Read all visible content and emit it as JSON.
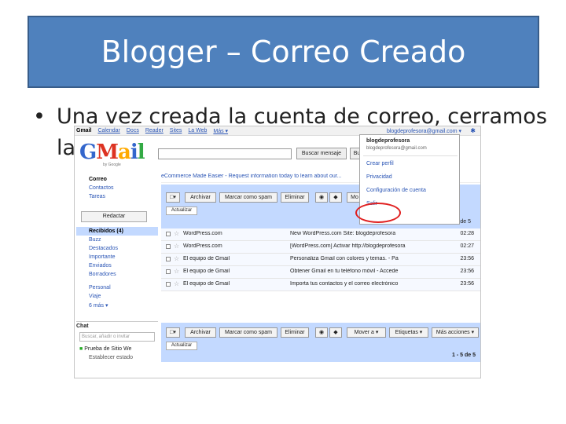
{
  "slide": {
    "title": "Blogger – Correo Creado",
    "bullet_line1": "Una vez creada la cuenta de correo, cerramos",
    "bullet_line2": "la"
  },
  "gmail": {
    "topnav": [
      "Gmail",
      "Calendar",
      "Docs",
      "Reader",
      "Sites",
      "La Web",
      "Más ▾"
    ],
    "account_email": "blogdeprofesora@gmail.com ▾",
    "logo": "Gmail",
    "logo_sub": "by Google",
    "search_button": "Buscar mensaje",
    "search_button2": "Bu",
    "nav_items": [
      "Correo",
      "Contactos",
      "Tareas"
    ],
    "compose": "Redactar",
    "folders": [
      "Recibidos (4)",
      "Buzz",
      "Destacados",
      "Importante",
      "Enviados",
      "Borradores"
    ],
    "labels": [
      "Personal",
      "Viaje",
      "6 más ▾"
    ],
    "chat": {
      "header": "Chat",
      "search_placeholder": "Buscar, añadir o invitar",
      "contact": "Prueba de Sitio We",
      "status": "Establecer estado"
    },
    "promo": "eCommerce Made Easier - Request information today to learn about our...",
    "toolbar": {
      "archive": "Archivar",
      "spam": "Marcar como spam",
      "delete": "Eliminar",
      "move": "Mover a ▾",
      "labels_btn": "Etiquetas ▾",
      "more": "Más acciones ▾",
      "refresh": "Actualizar",
      "count": "1 - 5 de 5"
    },
    "emails": [
      {
        "sender": "WordPress.com",
        "subject": "New WordPress.com Site: blogdeprofesora",
        "time": "02:28"
      },
      {
        "sender": "WordPress.com",
        "subject": "[WordPress.com] Activar http://blogdeprofesora",
        "time": "02:27"
      },
      {
        "sender": "El equipo de Gmail",
        "subject": "Personaliza Gmail con colores y temas. - Pa",
        "time": "23:56"
      },
      {
        "sender": "El equipo de Gmail",
        "subject": "Obtener Gmail en tu teléfono móvil - Accede",
        "time": "23:56"
      },
      {
        "sender": "El equipo de Gmail",
        "subject": "Importa tus contactos y el correo electrónico",
        "time": "23:56"
      }
    ],
    "dropdown": {
      "name": "blogdeprofesora",
      "email": "blogdeprofesora@gmail.com",
      "items": [
        "Crear perfil",
        "Privacidad",
        "Configuración de cuenta",
        "Salir"
      ]
    }
  },
  "colors": {
    "title_bg": "#4f81bd",
    "gmail_toolbar": "#c3d9ff",
    "highlight": "#e02020"
  }
}
